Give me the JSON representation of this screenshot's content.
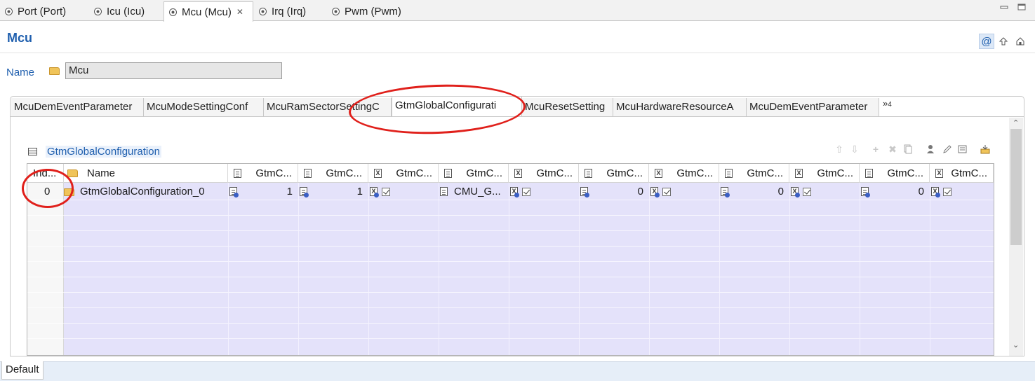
{
  "editor_tabs": [
    {
      "label": "Port (Port)"
    },
    {
      "label": "Icu (Icu)"
    },
    {
      "label": "Mcu (Mcu)",
      "active": true,
      "close": "✕"
    },
    {
      "label": "Irq (Irq)"
    },
    {
      "label": "Pwm (Pwm)"
    }
  ],
  "header": {
    "title": "Mcu"
  },
  "name_field": {
    "label": "Name",
    "value": "Mcu"
  },
  "section_tabs": [
    "McuDemEventParameter",
    "McuModeSettingConf",
    "McuRamSectorSettingC",
    "GtmGlobalConfigurati",
    "McuResetSetting",
    "McuHardwareResourceA",
    "McuDemEventParameter"
  ],
  "more_tabs": {
    "symbol": "»",
    "count": "4"
  },
  "table": {
    "title": "GtmGlobalConfiguration",
    "columns": [
      {
        "label": "Ind..."
      },
      {
        "label": "Name"
      },
      {
        "label": "GtmC..."
      },
      {
        "label": "GtmC..."
      },
      {
        "label": "GtmC..."
      },
      {
        "label": "GtmC..."
      },
      {
        "label": "GtmC..."
      },
      {
        "label": "GtmC..."
      },
      {
        "label": "GtmC..."
      },
      {
        "label": "GtmC..."
      },
      {
        "label": "GtmC..."
      },
      {
        "label": "GtmC..."
      },
      {
        "label": "GtmC..."
      }
    ],
    "rows": [
      {
        "index": "0",
        "name": "GtmGlobalConfiguration_0",
        "c1": "1",
        "c2": "1",
        "c4": "CMU_G...",
        "c6": "0",
        "c8": "0",
        "c10": "0"
      }
    ]
  },
  "bottom_tabs": {
    "default": "Default"
  },
  "colors": {
    "accent": "#1f5fae",
    "row_fill": "#e4e2fa",
    "annotation": "#e0201b"
  }
}
